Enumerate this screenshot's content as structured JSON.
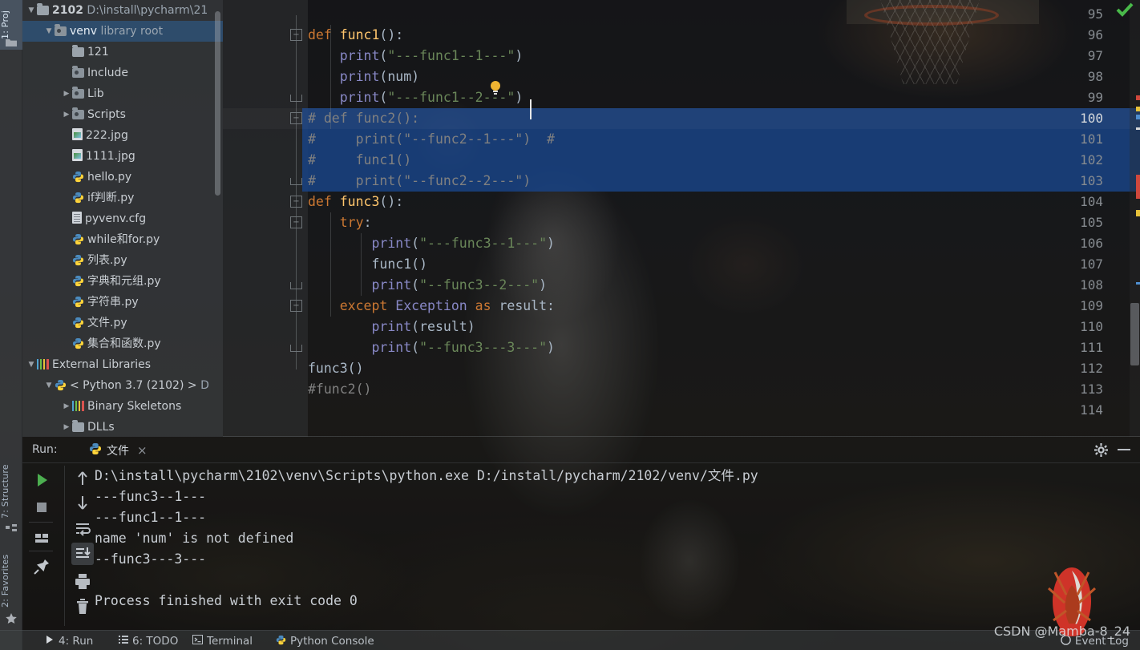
{
  "app": {
    "name": "PyCharm",
    "theme_bg": "#2b2b2b",
    "accent": "#4f5d6e"
  },
  "left_strip": {
    "tabs": [
      {
        "id": "project",
        "label": "1: Proj",
        "icon": "folder-icon",
        "active": true
      },
      {
        "id": "structure",
        "label": "7: Structure",
        "icon": "structure-icon",
        "active": false
      },
      {
        "id": "favorites",
        "label": "2: Favorites",
        "icon": "star-icon",
        "active": false
      }
    ]
  },
  "project_tree": {
    "rows": [
      {
        "indent": 1,
        "twisty": "▼",
        "icon": "folder-icon",
        "label": "2102",
        "bold": true,
        "path": "D:\\install\\pycharm\\21",
        "selected": false
      },
      {
        "indent": 2,
        "twisty": "▼",
        "icon": "folder-venv-icon",
        "label": "venv",
        "tag": "library root",
        "selected": true
      },
      {
        "indent": 3,
        "twisty": "",
        "icon": "folder-icon",
        "label": "121",
        "selected": false
      },
      {
        "indent": 3,
        "twisty": "",
        "icon": "folder-venv-icon",
        "label": "Include",
        "selected": false
      },
      {
        "indent": 3,
        "twisty": "▶",
        "icon": "folder-venv-icon",
        "label": "Lib",
        "selected": false
      },
      {
        "indent": 3,
        "twisty": "▶",
        "icon": "folder-venv-icon",
        "label": "Scripts",
        "selected": false
      },
      {
        "indent": 3,
        "twisty": "",
        "icon": "image-file-icon",
        "label": "222.jpg",
        "selected": false
      },
      {
        "indent": 3,
        "twisty": "",
        "icon": "image-file-icon",
        "label": "1111.jpg",
        "selected": false
      },
      {
        "indent": 3,
        "twisty": "",
        "icon": "python-file-icon",
        "label": "hello.py",
        "selected": false
      },
      {
        "indent": 3,
        "twisty": "",
        "icon": "python-file-icon",
        "label": "if判断.py",
        "selected": false
      },
      {
        "indent": 3,
        "twisty": "",
        "icon": "config-file-icon",
        "label": "pyvenv.cfg",
        "selected": false
      },
      {
        "indent": 3,
        "twisty": "",
        "icon": "python-file-icon",
        "label": "while和for.py",
        "selected": false
      },
      {
        "indent": 3,
        "twisty": "",
        "icon": "python-file-icon",
        "label": "列表.py",
        "selected": false
      },
      {
        "indent": 3,
        "twisty": "",
        "icon": "python-file-icon",
        "label": "字典和元组.py",
        "selected": false
      },
      {
        "indent": 3,
        "twisty": "",
        "icon": "python-file-icon",
        "label": "字符串.py",
        "selected": false
      },
      {
        "indent": 3,
        "twisty": "",
        "icon": "python-file-icon",
        "label": "文件.py",
        "selected": false
      },
      {
        "indent": 3,
        "twisty": "",
        "icon": "python-file-icon",
        "label": "集合和函数.py",
        "selected": false
      },
      {
        "indent": 1,
        "twisty": "▼",
        "icon": "libraries-icon",
        "label": "External Libraries",
        "selected": false
      },
      {
        "indent": 2,
        "twisty": "▼",
        "icon": "python-sdk-icon",
        "label": "< Python 3.7 (2102) >",
        "tag": "D",
        "selected": false
      },
      {
        "indent": 3,
        "twisty": "▶",
        "icon": "libraries-icon",
        "label": "Binary Skeletons",
        "selected": false
      },
      {
        "indent": 3,
        "twisty": "▶",
        "icon": "folder-icon",
        "label": "DLLs",
        "selected": false
      }
    ]
  },
  "editor": {
    "current_line": 100,
    "selected_lines": [
      100,
      101,
      102,
      103
    ],
    "lines": [
      {
        "n": 95,
        "tokens": []
      },
      {
        "n": 96,
        "fold": "open",
        "tokens": [
          {
            "t": "def",
            "c": "k-def"
          },
          {
            "t": " ",
            "c": "plain"
          },
          {
            "t": "func1",
            "c": "fn"
          },
          {
            "t": "():",
            "c": "plain"
          }
        ]
      },
      {
        "n": 97,
        "tokens": [
          {
            "t": "    ",
            "c": "plain"
          },
          {
            "t": "print",
            "c": "bi"
          },
          {
            "t": "(",
            "c": "plain"
          },
          {
            "t": "\"---func1--1---\"",
            "c": "str"
          },
          {
            "t": ")",
            "c": "plain"
          }
        ]
      },
      {
        "n": 98,
        "tokens": [
          {
            "t": "    ",
            "c": "plain"
          },
          {
            "t": "print",
            "c": "bi"
          },
          {
            "t": "(",
            "c": "plain"
          },
          {
            "t": "num",
            "c": "ident"
          },
          {
            "t": ")",
            "c": "plain"
          }
        ]
      },
      {
        "n": 99,
        "fold": "end",
        "bulb": true,
        "tokens": [
          {
            "t": "    ",
            "c": "plain"
          },
          {
            "t": "print",
            "c": "bi"
          },
          {
            "t": "(",
            "c": "plain"
          },
          {
            "t": "\"---func1--2---\"",
            "c": "str"
          },
          {
            "t": ")",
            "c": "plain"
          }
        ]
      },
      {
        "n": 100,
        "fold": "open",
        "tokens": [
          {
            "t": "# def func2():",
            "c": "cmt"
          }
        ]
      },
      {
        "n": 101,
        "tokens": [
          {
            "t": "#     print(\"--func2--1---\")  #",
            "c": "cmt"
          }
        ]
      },
      {
        "n": 102,
        "tokens": [
          {
            "t": "#     func1()",
            "c": "cmt"
          }
        ]
      },
      {
        "n": 103,
        "fold": "end",
        "tokens": [
          {
            "t": "#     print(\"--func2--2---\")",
            "c": "cmt"
          }
        ]
      },
      {
        "n": 104,
        "fold": "open",
        "tokens": [
          {
            "t": "def",
            "c": "k-def"
          },
          {
            "t": " ",
            "c": "plain"
          },
          {
            "t": "func3",
            "c": "fn"
          },
          {
            "t": "():",
            "c": "plain"
          }
        ]
      },
      {
        "n": 105,
        "fold": "open",
        "tokens": [
          {
            "t": "    ",
            "c": "plain"
          },
          {
            "t": "try",
            "c": "k-kw"
          },
          {
            "t": ":",
            "c": "plain"
          }
        ]
      },
      {
        "n": 106,
        "tokens": [
          {
            "t": "        ",
            "c": "plain"
          },
          {
            "t": "print",
            "c": "bi"
          },
          {
            "t": "(",
            "c": "plain"
          },
          {
            "t": "\"---func3--1---\"",
            "c": "str"
          },
          {
            "t": ")",
            "c": "plain"
          }
        ]
      },
      {
        "n": 107,
        "tokens": [
          {
            "t": "        ",
            "c": "plain"
          },
          {
            "t": "func1",
            "c": "ident"
          },
          {
            "t": "()",
            "c": "plain"
          }
        ]
      },
      {
        "n": 108,
        "fold": "end",
        "tokens": [
          {
            "t": "        ",
            "c": "plain"
          },
          {
            "t": "print",
            "c": "bi"
          },
          {
            "t": "(",
            "c": "plain"
          },
          {
            "t": "\"--func3--2---\"",
            "c": "str"
          },
          {
            "t": ")",
            "c": "plain"
          }
        ]
      },
      {
        "n": 109,
        "fold": "open",
        "tokens": [
          {
            "t": "    ",
            "c": "plain"
          },
          {
            "t": "except",
            "c": "k-kw"
          },
          {
            "t": " ",
            "c": "plain"
          },
          {
            "t": "Exception",
            "c": "exc"
          },
          {
            "t": " ",
            "c": "plain"
          },
          {
            "t": "as",
            "c": "k-kw"
          },
          {
            "t": " result:",
            "c": "plain"
          }
        ]
      },
      {
        "n": 110,
        "tokens": [
          {
            "t": "        ",
            "c": "plain"
          },
          {
            "t": "print",
            "c": "bi"
          },
          {
            "t": "(",
            "c": "plain"
          },
          {
            "t": "result",
            "c": "ident"
          },
          {
            "t": ")",
            "c": "plain"
          }
        ]
      },
      {
        "n": 111,
        "fold": "end",
        "tokens": [
          {
            "t": "        ",
            "c": "plain"
          },
          {
            "t": "print",
            "c": "bi"
          },
          {
            "t": "(",
            "c": "plain"
          },
          {
            "t": "\"--func3---3---\"",
            "c": "str"
          },
          {
            "t": ")",
            "c": "plain"
          }
        ]
      },
      {
        "n": 112,
        "tokens": [
          {
            "t": "func3",
            "c": "ident"
          },
          {
            "t": "()",
            "c": "plain"
          }
        ]
      },
      {
        "n": 113,
        "tokens": [
          {
            "t": "#func2()",
            "c": "cmt"
          }
        ]
      },
      {
        "n": 114,
        "tokens": []
      }
    ]
  },
  "run_panel": {
    "label": "Run:",
    "tab": {
      "icon": "python-file-icon",
      "label": "文件",
      "close": "×"
    },
    "gear_icon": "gear-icon",
    "minimize_icon": "minimize-icon",
    "toolbar_left": [
      {
        "name": "rerun-button",
        "icon": "play-icon"
      },
      {
        "name": "stop-button",
        "icon": "stop-icon"
      },
      {
        "name": "layout-button",
        "icon": "layout-icon"
      },
      {
        "name": "pin-tab-button",
        "icon": "pin-icon"
      }
    ],
    "toolbar_right": [
      {
        "name": "up-stack-button",
        "icon": "arrow-up-icon"
      },
      {
        "name": "down-stack-button",
        "icon": "arrow-down-icon"
      },
      {
        "name": "soft-wrap-button",
        "icon": "soft-wrap-icon"
      },
      {
        "name": "scroll-end-button",
        "icon": "scroll-to-end-icon",
        "selected": true
      },
      {
        "name": "print-button",
        "icon": "printer-icon"
      },
      {
        "name": "clear-all-button",
        "icon": "trash-icon"
      }
    ],
    "console_lines": [
      "D:\\install\\pycharm\\2102\\venv\\Scripts\\python.exe D:/install/pycharm/2102/venv/文件.py",
      "---func3--1---",
      "---func1--1---",
      "name 'num' is not defined",
      "--func3---3---",
      "",
      "Process finished with exit code 0"
    ]
  },
  "status_bar": {
    "tabs": [
      {
        "id": "run",
        "label": "4: Run",
        "icon": "play-icon"
      },
      {
        "id": "todo",
        "label": "6: TODO",
        "icon": "todo-icon"
      },
      {
        "id": "terminal",
        "label": "Terminal",
        "icon": "terminal-icon"
      },
      {
        "id": "pycon",
        "label": "Python Console",
        "icon": "python-console-icon"
      }
    ],
    "event_log": {
      "label": "Event Log",
      "icon": "event-log-icon"
    }
  },
  "overlay": {
    "watermark": "CSDN @Mamba-8_24",
    "inspection_status_icon": "green-check-icon"
  }
}
